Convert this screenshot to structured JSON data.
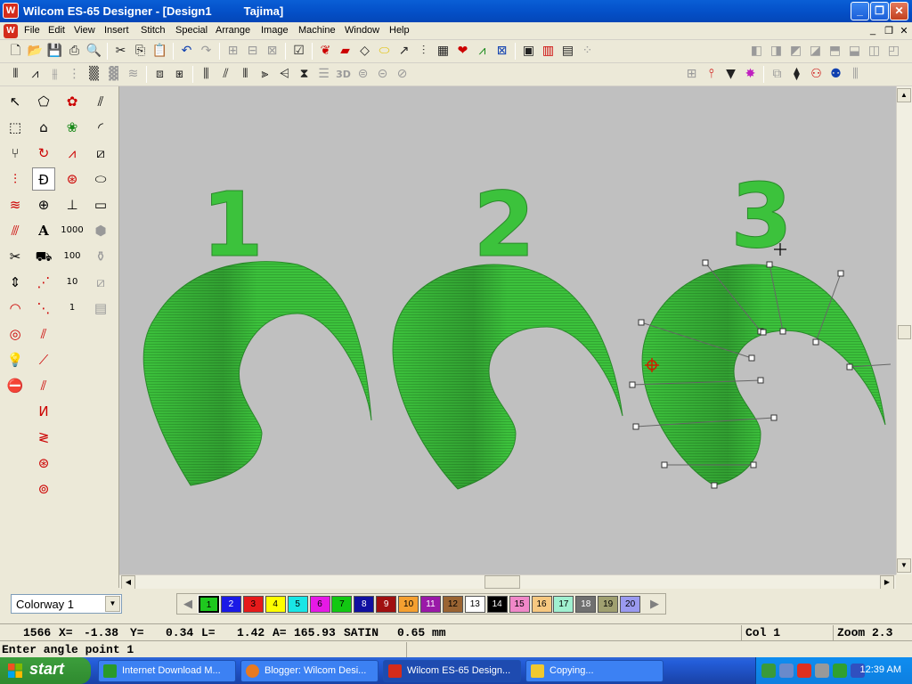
{
  "window": {
    "logo": "W",
    "title": "Wilcom ES-65 Designer - [Design1          Tajima]",
    "minimize": "_",
    "restore": "❐",
    "close": "✕"
  },
  "menu": {
    "items": [
      "File",
      "Edit",
      "View",
      "Insert",
      "Stitch",
      "Special",
      "Arrange",
      "Image",
      "Machine",
      "Window",
      "Help"
    ],
    "doc_minimize": "_",
    "doc_restore": "❐",
    "doc_close": "✕"
  },
  "canvas": {
    "background": "#c0c0c0",
    "embroidery_color": "#3cc23c",
    "digits": [
      "1",
      "2",
      "3"
    ]
  },
  "colorway": {
    "selected": "Colorway 1",
    "dropdown_icon": "▼"
  },
  "palette": {
    "left_arrow": "◀",
    "right_arrow": "▶",
    "swatches": [
      {
        "label": "1",
        "color": "#1ec81e"
      },
      {
        "label": "2",
        "color": "#1a1ae6"
      },
      {
        "label": "3",
        "color": "#e61a1a"
      },
      {
        "label": "4",
        "color": "#ffff00"
      },
      {
        "label": "5",
        "color": "#19e6e6"
      },
      {
        "label": "6",
        "color": "#e619e6"
      },
      {
        "label": "7",
        "color": "#12c812"
      },
      {
        "label": "8",
        "color": "#1010a0"
      },
      {
        "label": "9",
        "color": "#a01010"
      },
      {
        "label": "10",
        "color": "#f5a030"
      },
      {
        "label": "11",
        "color": "#9a19a8"
      },
      {
        "label": "12",
        "color": "#9a6432"
      },
      {
        "label": "13",
        "color": "#ffffff"
      },
      {
        "label": "14",
        "color": "#000000"
      },
      {
        "label": "15",
        "color": "#f088c8"
      },
      {
        "label": "16",
        "color": "#f7c880"
      },
      {
        "label": "17",
        "color": "#a0f0d0"
      },
      {
        "label": "18",
        "color": "#707070"
      },
      {
        "label": "19",
        "color": "#a0a070"
      },
      {
        "label": "20",
        "color": "#9a9af0"
      }
    ]
  },
  "status": {
    "count": "1566",
    "x_label": "X=",
    "x_value": "-1.38",
    "y_label": "Y=",
    "y_value": "0.34",
    "l_label": "L=",
    "l_value": "1.42",
    "a_label": "A=",
    "a_value": "165.93",
    "stitch_type": "SATIN",
    "spacing": "0.65 mm",
    "col": "Col 1",
    "zoom": "Zoom 2.3",
    "prompt": "Enter angle point 1"
  },
  "taskbar": {
    "start": "start",
    "tasks": [
      {
        "label": "Internet Download M...",
        "icon_color": "#2a9a2a"
      },
      {
        "label": "Blogger: Wilcom Desi...",
        "icon_color": "#e87a20"
      },
      {
        "label": "Wilcom ES-65 Design...",
        "icon_color": "#d42c1c"
      },
      {
        "label": "Copying...",
        "icon_color": "#f0c830"
      }
    ],
    "clock": "12:39 AM"
  }
}
